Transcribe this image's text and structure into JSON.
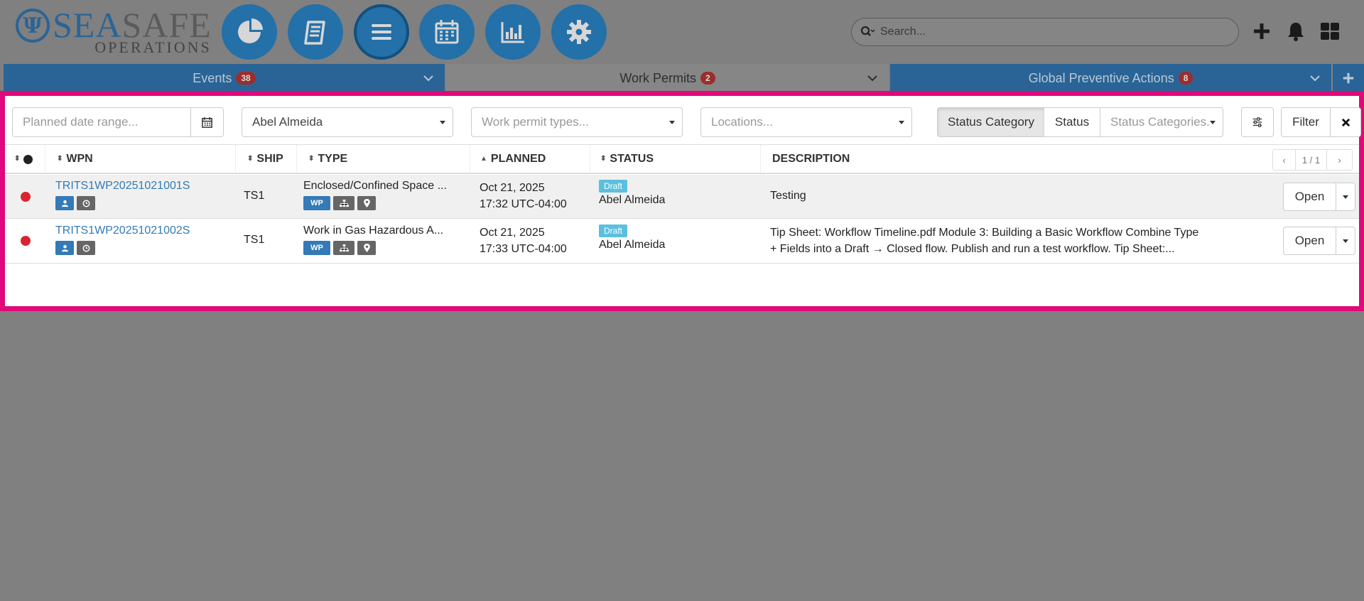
{
  "logo": {
    "mark": "Ψ",
    "sea_part1": "SEA",
    "sea_part2": "SAFE",
    "sub": "OPERATIONS"
  },
  "header": {
    "search_placeholder": "Search...",
    "nav": [
      "dashboard-icon",
      "logbook-icon",
      "menu-icon",
      "calendar-icon",
      "reports-icon",
      "settings-icon"
    ]
  },
  "tabs": [
    {
      "label": "Events",
      "count": "38"
    },
    {
      "label": "Work Permits",
      "count": "2"
    },
    {
      "label": "Global Preventive Actions",
      "count": "8"
    }
  ],
  "filters": {
    "date_placeholder": "Planned date range...",
    "person_value": "Abel Almeida",
    "types_placeholder": "Work permit types...",
    "locations_placeholder": "Locations...",
    "seg_status_category": "Status Category",
    "seg_status": "Status",
    "status_categories_placeholder": "Status Categories...",
    "filter_label": "Filter"
  },
  "table": {
    "columns": [
      "WPN",
      "SHIP",
      "TYPE",
      "PLANNED",
      "STATUS",
      "DESCRIPTION"
    ],
    "pager": {
      "prev": "‹",
      "page": "1 / 1",
      "next": "›"
    },
    "rows": [
      {
        "wpn": "TRITS1WP20251021001S",
        "ship": "TS1",
        "type": "Enclosed/Confined Space ...",
        "planned_date": "Oct 21, 2025",
        "planned_time": "17:32 UTC-04:00",
        "status_badge": "Draft",
        "status_user": "Abel Almeida",
        "description": "Testing",
        "action": "Open"
      },
      {
        "wpn": "TRITS1WP20251021002S",
        "ship": "TS1",
        "type": "Work in Gas Hazardous A...",
        "planned_date": "Oct 21, 2025",
        "planned_time": "17:33 UTC-04:00",
        "status_badge": "Draft",
        "status_user": "Abel Almeida",
        "description_line1": "Tip Sheet: Workflow Timeline.pdf Module 3: Building a Basic Workflow Combine Type",
        "description_line2": "+ Fields into a Draft → Closed flow. Publish and run a test workflow. Tip Sheet:...",
        "action": "Open"
      }
    ],
    "wp_badge": "WP"
  },
  "colors": {
    "brand": "#2a6496",
    "highlight": "#e0087a",
    "danger_dot": "#d9242f",
    "draft": "#5bc0de"
  }
}
